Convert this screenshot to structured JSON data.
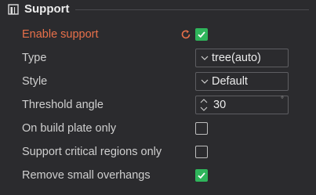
{
  "section": {
    "title": "Support",
    "icon": "support-settings-icon"
  },
  "rows": [
    {
      "label": "Enable support",
      "control": "checkbox",
      "checked": true,
      "modified": true,
      "reset_icon": "reset-arrow-icon",
      "accent": "#e8704a"
    },
    {
      "label": "Type",
      "control": "combo",
      "value": "tree(auto)"
    },
    {
      "label": "Style",
      "control": "combo",
      "value": "Default"
    },
    {
      "label": "Threshold angle",
      "control": "spin",
      "value": "30",
      "unit": "°"
    },
    {
      "label": "On build plate only",
      "control": "checkbox",
      "checked": false
    },
    {
      "label": "Support critical regions only",
      "control": "checkbox",
      "checked": false
    },
    {
      "label": "Remove small overhangs",
      "control": "checkbox",
      "checked": true
    }
  ],
  "colors": {
    "background": "#2b2b2e",
    "checked": "#2fb55b",
    "modified_label": "#e8704a",
    "text": "#cfcfcf"
  }
}
